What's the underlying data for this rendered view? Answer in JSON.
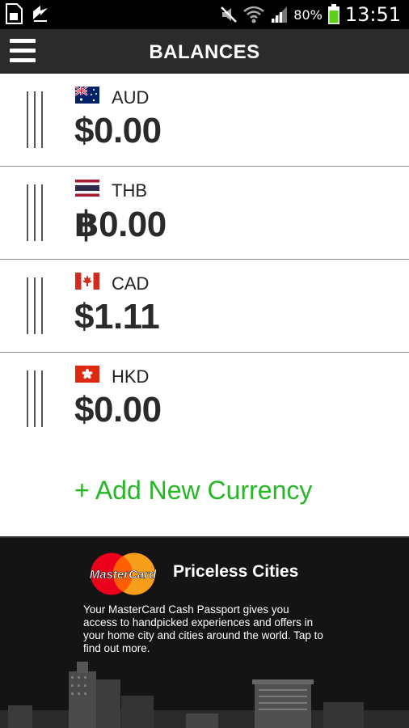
{
  "status_bar": {
    "battery_percent": "80%",
    "time": "13:51",
    "icons": [
      "sim-card-icon",
      "usb-icon",
      "mute-icon",
      "wifi-icon",
      "signal-icon",
      "battery-icon"
    ]
  },
  "header": {
    "title": "BALANCES",
    "menu_icon": "hamburger-menu-icon"
  },
  "balances": [
    {
      "code": "AUD",
      "amount": "$0.00",
      "flag": "australia-flag-icon"
    },
    {
      "code": "THB",
      "amount": "฿0.00",
      "flag": "thailand-flag-icon"
    },
    {
      "code": "CAD",
      "amount": "$1.11",
      "flag": "canada-flag-icon"
    },
    {
      "code": "HKD",
      "amount": "$0.00",
      "flag": "hong-kong-flag-icon"
    }
  ],
  "add_currency": {
    "label": "+ Add New Currency"
  },
  "promo": {
    "logo_text": "MasterCard",
    "title": "Priceless Cities",
    "text": "Your MasterCard Cash Passport gives you access to handpicked experiences and offers in your home city and cities around the world. Tap to find out more."
  },
  "colors": {
    "header_bg": "#2b2b2b",
    "accent_green": "#26b726",
    "mc_red": "#eb001b",
    "mc_orange": "#f79e1b"
  }
}
